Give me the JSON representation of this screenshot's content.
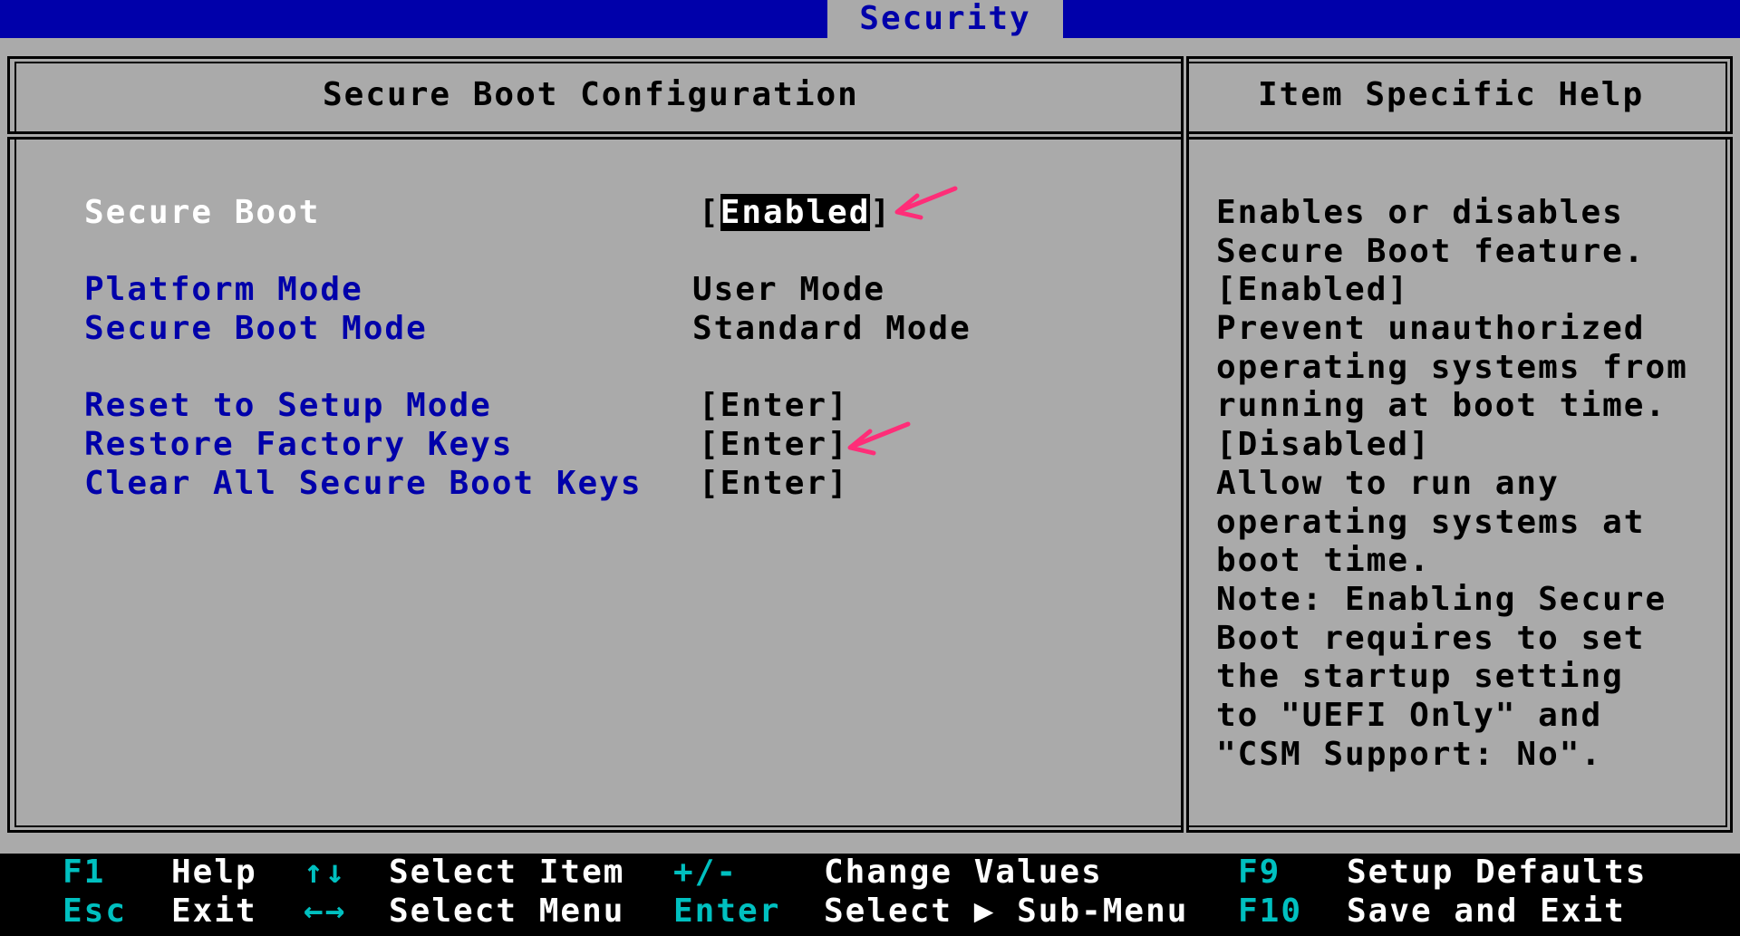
{
  "top_tab": {
    "label": "Security"
  },
  "left_panel": {
    "title": "Secure Boot Configuration",
    "items": [
      {
        "label": "Secure Boot",
        "value": "Enabled"
      },
      {
        "label": "Platform Mode",
        "value": "User Mode"
      },
      {
        "label": "Secure Boot Mode",
        "value": "Standard Mode"
      },
      {
        "label": "Reset to Setup Mode",
        "value": "[Enter]"
      },
      {
        "label": "Restore Factory Keys",
        "value": "[Enter]"
      },
      {
        "label": "Clear All Secure Boot Keys",
        "value": "[Enter]"
      }
    ]
  },
  "right_panel": {
    "title": "Item Specific Help",
    "lines": [
      "Enables or disables",
      "Secure Boot feature.",
      "[Enabled]",
      "Prevent unauthorized",
      "operating systems from",
      "running at boot time.",
      "[Disabled]",
      "Allow to run any",
      "operating systems at",
      "boot time.",
      "Note: Enabling Secure",
      "Boot requires to set",
      "the startup setting",
      "to \"UEFI Only\" and",
      "\"CSM Support: No\"."
    ]
  },
  "footer": {
    "keys": [
      {
        "key": "F1",
        "action": "Help"
      },
      {
        "key": "Esc",
        "action": "Exit"
      },
      {
        "key": "↑↓",
        "action": "Select Item"
      },
      {
        "key": "←→",
        "action": "Select Menu"
      },
      {
        "key": "+/-",
        "action": "Change Values"
      },
      {
        "key": "Enter",
        "action": "Select ▶ Sub-Menu"
      },
      {
        "key": "F9",
        "action": "Setup Defaults"
      },
      {
        "key": "F10",
        "action": "Save and Exit"
      }
    ]
  },
  "colors": {
    "background": "#aaaaaa",
    "title_bar": "#0000aa",
    "item_blue": "#0000aa",
    "footer_key": "#00c0c0",
    "annotation_arrow": "#ff2d78"
  },
  "icons": {
    "annotation": "arrow-pointer-icon"
  }
}
